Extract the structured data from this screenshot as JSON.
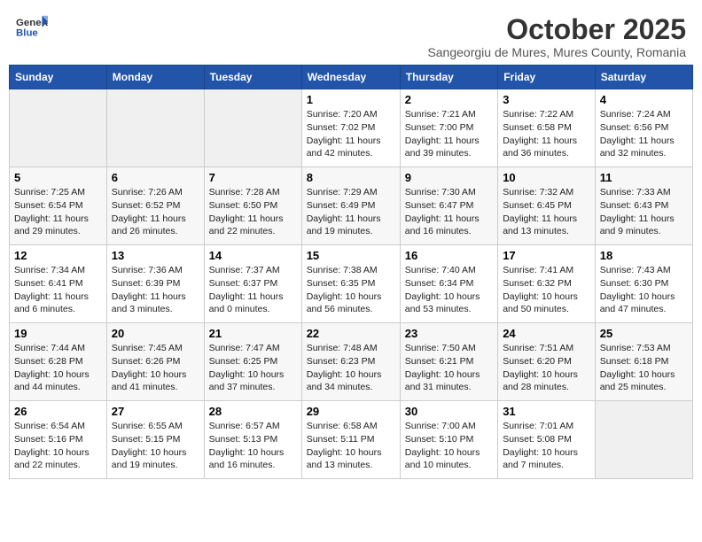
{
  "header": {
    "logo_general": "General",
    "logo_blue": "Blue",
    "title": "October 2025",
    "subtitle": "Sangeorgiu de Mures, Mures County, Romania"
  },
  "columns": [
    "Sunday",
    "Monday",
    "Tuesday",
    "Wednesday",
    "Thursday",
    "Friday",
    "Saturday"
  ],
  "weeks": [
    [
      {
        "day": "",
        "info": ""
      },
      {
        "day": "",
        "info": ""
      },
      {
        "day": "",
        "info": ""
      },
      {
        "day": "1",
        "info": "Sunrise: 7:20 AM\nSunset: 7:02 PM\nDaylight: 11 hours\nand 42 minutes."
      },
      {
        "day": "2",
        "info": "Sunrise: 7:21 AM\nSunset: 7:00 PM\nDaylight: 11 hours\nand 39 minutes."
      },
      {
        "day": "3",
        "info": "Sunrise: 7:22 AM\nSunset: 6:58 PM\nDaylight: 11 hours\nand 36 minutes."
      },
      {
        "day": "4",
        "info": "Sunrise: 7:24 AM\nSunset: 6:56 PM\nDaylight: 11 hours\nand 32 minutes."
      }
    ],
    [
      {
        "day": "5",
        "info": "Sunrise: 7:25 AM\nSunset: 6:54 PM\nDaylight: 11 hours\nand 29 minutes."
      },
      {
        "day": "6",
        "info": "Sunrise: 7:26 AM\nSunset: 6:52 PM\nDaylight: 11 hours\nand 26 minutes."
      },
      {
        "day": "7",
        "info": "Sunrise: 7:28 AM\nSunset: 6:50 PM\nDaylight: 11 hours\nand 22 minutes."
      },
      {
        "day": "8",
        "info": "Sunrise: 7:29 AM\nSunset: 6:49 PM\nDaylight: 11 hours\nand 19 minutes."
      },
      {
        "day": "9",
        "info": "Sunrise: 7:30 AM\nSunset: 6:47 PM\nDaylight: 11 hours\nand 16 minutes."
      },
      {
        "day": "10",
        "info": "Sunrise: 7:32 AM\nSunset: 6:45 PM\nDaylight: 11 hours\nand 13 minutes."
      },
      {
        "day": "11",
        "info": "Sunrise: 7:33 AM\nSunset: 6:43 PM\nDaylight: 11 hours\nand 9 minutes."
      }
    ],
    [
      {
        "day": "12",
        "info": "Sunrise: 7:34 AM\nSunset: 6:41 PM\nDaylight: 11 hours\nand 6 minutes."
      },
      {
        "day": "13",
        "info": "Sunrise: 7:36 AM\nSunset: 6:39 PM\nDaylight: 11 hours\nand 3 minutes."
      },
      {
        "day": "14",
        "info": "Sunrise: 7:37 AM\nSunset: 6:37 PM\nDaylight: 11 hours\nand 0 minutes."
      },
      {
        "day": "15",
        "info": "Sunrise: 7:38 AM\nSunset: 6:35 PM\nDaylight: 10 hours\nand 56 minutes."
      },
      {
        "day": "16",
        "info": "Sunrise: 7:40 AM\nSunset: 6:34 PM\nDaylight: 10 hours\nand 53 minutes."
      },
      {
        "day": "17",
        "info": "Sunrise: 7:41 AM\nSunset: 6:32 PM\nDaylight: 10 hours\nand 50 minutes."
      },
      {
        "day": "18",
        "info": "Sunrise: 7:43 AM\nSunset: 6:30 PM\nDaylight: 10 hours\nand 47 minutes."
      }
    ],
    [
      {
        "day": "19",
        "info": "Sunrise: 7:44 AM\nSunset: 6:28 PM\nDaylight: 10 hours\nand 44 minutes."
      },
      {
        "day": "20",
        "info": "Sunrise: 7:45 AM\nSunset: 6:26 PM\nDaylight: 10 hours\nand 41 minutes."
      },
      {
        "day": "21",
        "info": "Sunrise: 7:47 AM\nSunset: 6:25 PM\nDaylight: 10 hours\nand 37 minutes."
      },
      {
        "day": "22",
        "info": "Sunrise: 7:48 AM\nSunset: 6:23 PM\nDaylight: 10 hours\nand 34 minutes."
      },
      {
        "day": "23",
        "info": "Sunrise: 7:50 AM\nSunset: 6:21 PM\nDaylight: 10 hours\nand 31 minutes."
      },
      {
        "day": "24",
        "info": "Sunrise: 7:51 AM\nSunset: 6:20 PM\nDaylight: 10 hours\nand 28 minutes."
      },
      {
        "day": "25",
        "info": "Sunrise: 7:53 AM\nSunset: 6:18 PM\nDaylight: 10 hours\nand 25 minutes."
      }
    ],
    [
      {
        "day": "26",
        "info": "Sunrise: 6:54 AM\nSunset: 5:16 PM\nDaylight: 10 hours\nand 22 minutes."
      },
      {
        "day": "27",
        "info": "Sunrise: 6:55 AM\nSunset: 5:15 PM\nDaylight: 10 hours\nand 19 minutes."
      },
      {
        "day": "28",
        "info": "Sunrise: 6:57 AM\nSunset: 5:13 PM\nDaylight: 10 hours\nand 16 minutes."
      },
      {
        "day": "29",
        "info": "Sunrise: 6:58 AM\nSunset: 5:11 PM\nDaylight: 10 hours\nand 13 minutes."
      },
      {
        "day": "30",
        "info": "Sunrise: 7:00 AM\nSunset: 5:10 PM\nDaylight: 10 hours\nand 10 minutes."
      },
      {
        "day": "31",
        "info": "Sunrise: 7:01 AM\nSunset: 5:08 PM\nDaylight: 10 hours\nand 7 minutes."
      },
      {
        "day": "",
        "info": ""
      }
    ]
  ]
}
